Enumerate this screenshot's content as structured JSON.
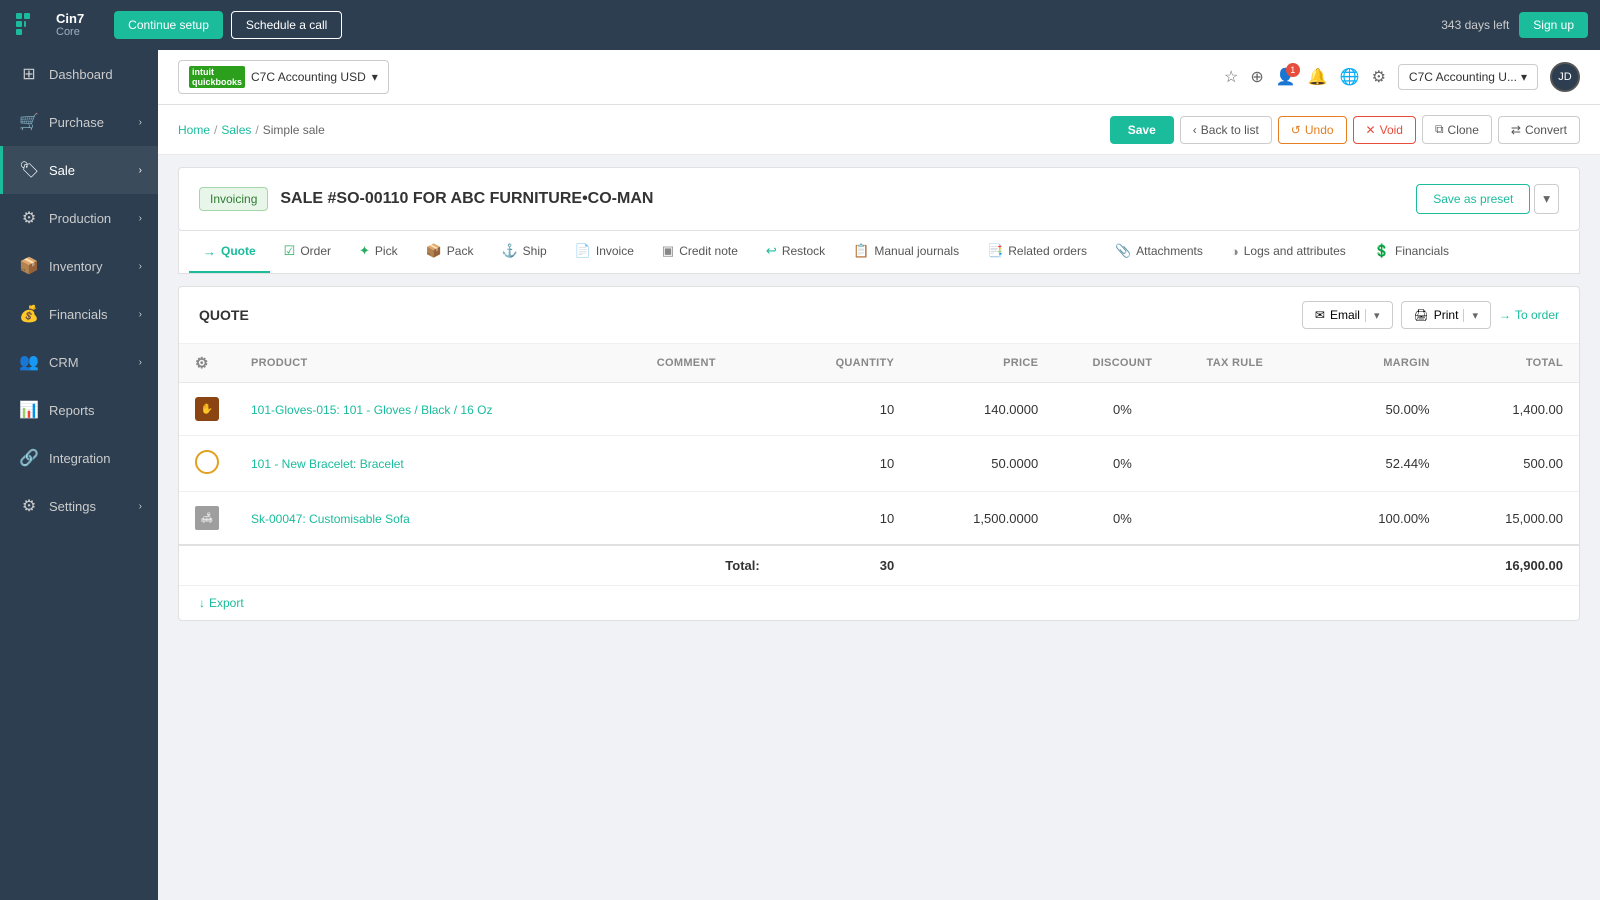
{
  "topNav": {
    "logo": "Cin7",
    "logoSub": "Core",
    "btnSetup": "Continue setup",
    "btnSchedule": "Schedule a call",
    "daysLeft": "343 days left",
    "btnSignup": "Sign up",
    "notificationCount": "1"
  },
  "sidebar": {
    "items": [
      {
        "id": "dashboard",
        "label": "Dashboard",
        "icon": "⊞",
        "hasChildren": false
      },
      {
        "id": "purchase",
        "label": "Purchase",
        "icon": "🛒",
        "hasChildren": true
      },
      {
        "id": "sale",
        "label": "Sale",
        "icon": "🏷",
        "hasChildren": true,
        "active": true
      },
      {
        "id": "production",
        "label": "Production",
        "icon": "⚙",
        "hasChildren": true
      },
      {
        "id": "inventory",
        "label": "Inventory",
        "icon": "📦",
        "hasChildren": true
      },
      {
        "id": "financials",
        "label": "Financials",
        "icon": "💰",
        "hasChildren": true
      },
      {
        "id": "crm",
        "label": "CRM",
        "icon": "👥",
        "hasChildren": true
      },
      {
        "id": "reports",
        "label": "Reports",
        "icon": "📊",
        "hasChildren": false
      },
      {
        "id": "integration",
        "label": "Integration",
        "icon": "🔗",
        "hasChildren": false
      },
      {
        "id": "settings",
        "label": "Settings",
        "icon": "⚙",
        "hasChildren": true
      }
    ]
  },
  "secondaryNav": {
    "quickbooksLabel": "C7C Accounting USD",
    "companySelector": "C7C Accounting U..."
  },
  "breadcrumb": {
    "home": "Home",
    "sales": "Sales",
    "current": "Simple sale"
  },
  "actionButtons": {
    "save": "Save",
    "backToList": "Back to list",
    "undo": "Undo",
    "void": "Void",
    "clone": "Clone",
    "convert": "Convert"
  },
  "invoiceHeader": {
    "badge": "Invoicing",
    "title": "SALE #SO-00110 FOR ABC FURNITURE•CO-MAN",
    "saveAsPreset": "Save as preset"
  },
  "tabs": [
    {
      "id": "quote",
      "label": "Quote",
      "icon": "→",
      "active": true
    },
    {
      "id": "order",
      "label": "Order",
      "icon": "☑"
    },
    {
      "id": "pick",
      "label": "Pick",
      "icon": "✦"
    },
    {
      "id": "pack",
      "label": "Pack",
      "icon": "📦"
    },
    {
      "id": "ship",
      "label": "Ship",
      "icon": "🚢"
    },
    {
      "id": "invoice",
      "label": "Invoice",
      "icon": "📄"
    },
    {
      "id": "credit-note",
      "label": "Credit note",
      "icon": "▣"
    },
    {
      "id": "restock",
      "label": "Restock",
      "icon": "↩"
    },
    {
      "id": "manual-journals",
      "label": "Manual journals",
      "icon": "📋"
    },
    {
      "id": "related-orders",
      "label": "Related orders",
      "icon": "📑"
    },
    {
      "id": "attachments",
      "label": "Attachments",
      "icon": "📎"
    },
    {
      "id": "logs",
      "label": "Logs and attributes",
      "icon": "◑"
    },
    {
      "id": "financials",
      "label": "Financials",
      "icon": "💲"
    }
  ],
  "quoteSection": {
    "title": "QUOTE",
    "emailBtn": "Email",
    "printBtn": "Print",
    "toOrderBtn": "To order"
  },
  "table": {
    "columns": [
      {
        "id": "product",
        "label": "PRODUCT"
      },
      {
        "id": "comment",
        "label": "COMMENT"
      },
      {
        "id": "quantity",
        "label": "QUANTITY"
      },
      {
        "id": "price",
        "label": "PRICE"
      },
      {
        "id": "discount",
        "label": "DISCOUNT"
      },
      {
        "id": "taxrule",
        "label": "TAX RULE"
      },
      {
        "id": "margin",
        "label": "MARGIN"
      },
      {
        "id": "total",
        "label": "TOTAL"
      }
    ],
    "rows": [
      {
        "id": 1,
        "productName": "101-Gloves-015: 101 - Gloves / Black / 16 Oz",
        "iconType": "gloves",
        "comment": "",
        "quantity": "10",
        "price": "140.0000",
        "discount": "0%",
        "taxRule": "",
        "margin": "50.00%",
        "total": "1,400.00"
      },
      {
        "id": 2,
        "productName": "101 - New Bracelet: Bracelet",
        "iconType": "bracelet",
        "comment": "",
        "quantity": "10",
        "price": "50.0000",
        "discount": "0%",
        "taxRule": "",
        "margin": "52.44%",
        "total": "500.00"
      },
      {
        "id": 3,
        "productName": "Sk-00047: Customisable Sofa",
        "iconType": "sofa",
        "comment": "",
        "quantity": "10",
        "price": "1,500.0000",
        "discount": "0%",
        "taxRule": "",
        "margin": "100.00%",
        "total": "15,000.00"
      }
    ],
    "totalRow": {
      "label": "Total:",
      "totalQty": "30",
      "totalAmount": "16,900.00"
    }
  },
  "exportBtn": "Export"
}
